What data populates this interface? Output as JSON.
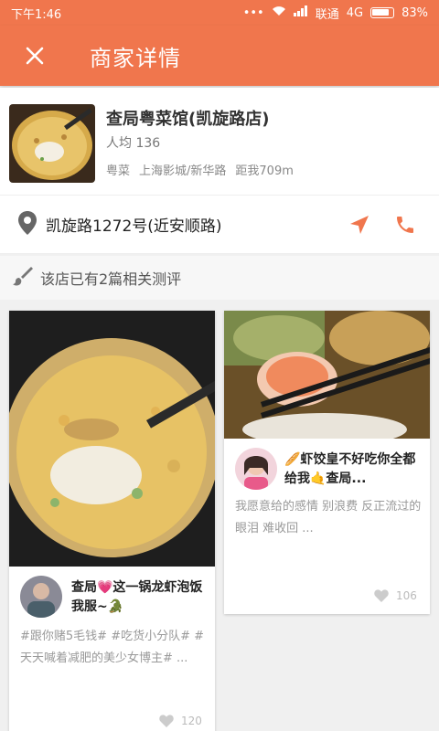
{
  "status_bar": {
    "time": "下午1:46",
    "carrier": "联通",
    "network": "4G",
    "battery": "83%"
  },
  "app_bar": {
    "title": "商家详情",
    "close_icon": "close-icon"
  },
  "shop": {
    "name": "查局粤菜馆(凯旋路店)",
    "avg_price": "人均 136",
    "cuisine": "粤菜",
    "area": "上海影城/新华路",
    "distance": "距我709m"
  },
  "address": {
    "text": "凯旋路1272号(近安顺路)",
    "pin_icon": "location-pin-icon",
    "navigate_icon": "navigate-arrow-icon",
    "phone_icon": "phone-icon"
  },
  "reviews": {
    "summary": "该店已有2篇相关测评",
    "icon": "brush-icon"
  },
  "posts": [
    {
      "title": "查局💗这一锅龙虾泡饭我服~🐊",
      "desc": "#跟你赌5毛钱# #吃货小分队# #天天喊着减肥的美少女博主# ...",
      "likes": "120"
    },
    {
      "title": "🥖虾饺皇不好吃你全都给我🤙查局...",
      "desc": "我愿意给的感情 别浪费 反正流过的眼泪 难收回 ...",
      "likes": "106"
    }
  ],
  "colors": {
    "accent": "#f0764d"
  }
}
